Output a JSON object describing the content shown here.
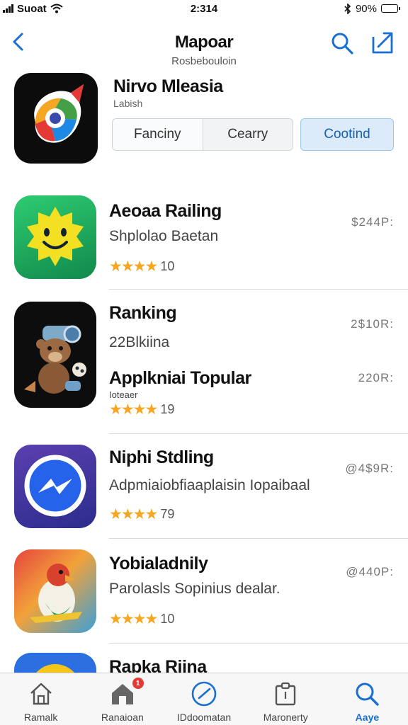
{
  "status_bar": {
    "carrier": "Suoat",
    "time": "2:314",
    "battery": "90%",
    "battery_level": 0.9
  },
  "nav": {
    "title": "Mapoar",
    "subtitle": "Rosbebouloin",
    "back_icon": "chevron-left-icon",
    "search_icon": "search-icon",
    "share_icon": "share-icon"
  },
  "featured": {
    "name": "Nirvo Mleasia",
    "sub": "Labish",
    "segments": [
      "Fanciny",
      "Cearry"
    ],
    "active_segment": "Cootind",
    "icon": "compass-logo-icon"
  },
  "apps": [
    {
      "name": "Aeoaa Railing",
      "desc": "Shplolao Baetan",
      "extra": "",
      "price": "$244P:",
      "stars": "★★★★",
      "rating": "10",
      "icon": "smiley-sun-icon"
    },
    {
      "name": "Ranking",
      "desc": "22Blkiina",
      "extra": "",
      "price": "2$10R:",
      "stars": "",
      "rating": "",
      "icon": "bear-character-icon"
    },
    {
      "name": "Applkniai Topular",
      "desc": "",
      "extra": "Ioteaer",
      "price": "220R:",
      "stars": "★★★★",
      "rating": "19",
      "icon": ""
    },
    {
      "name": "Niphi  Stdling",
      "desc": "Adpmiaiobfiaaplaisin Iopaibaal",
      "extra": "",
      "price": "@4$9R:",
      "stars": "★★★★",
      "rating": "79",
      "icon": "messenger-bolt-icon"
    },
    {
      "name": "Yobialadnily",
      "desc": "Parolasls Sopinius dealar.",
      "extra": "",
      "price": "@440P:",
      "stars": "★★★★",
      "rating": "10",
      "icon": "bird-character-icon"
    },
    {
      "name": "Rapka Riina",
      "desc": "",
      "extra": "",
      "price": "",
      "stars": "",
      "rating": "",
      "icon": "yellow-app-icon"
    }
  ],
  "tabs": [
    {
      "label": "Ramalk",
      "icon": "home-icon",
      "active": false,
      "badge": ""
    },
    {
      "label": "Ranaioan",
      "icon": "store-icon",
      "active": false,
      "badge": "1"
    },
    {
      "label": "IDdoomatan",
      "icon": "clock-icon",
      "active": false,
      "badge": ""
    },
    {
      "label": "Maronerty",
      "icon": "clipboard-icon",
      "active": false,
      "badge": ""
    },
    {
      "label": "Aaye",
      "icon": "search-icon",
      "active": true,
      "badge": ""
    }
  ],
  "colors": {
    "accent": "#1a6fd1",
    "star": "#f5a623",
    "badge": "#e53935"
  }
}
